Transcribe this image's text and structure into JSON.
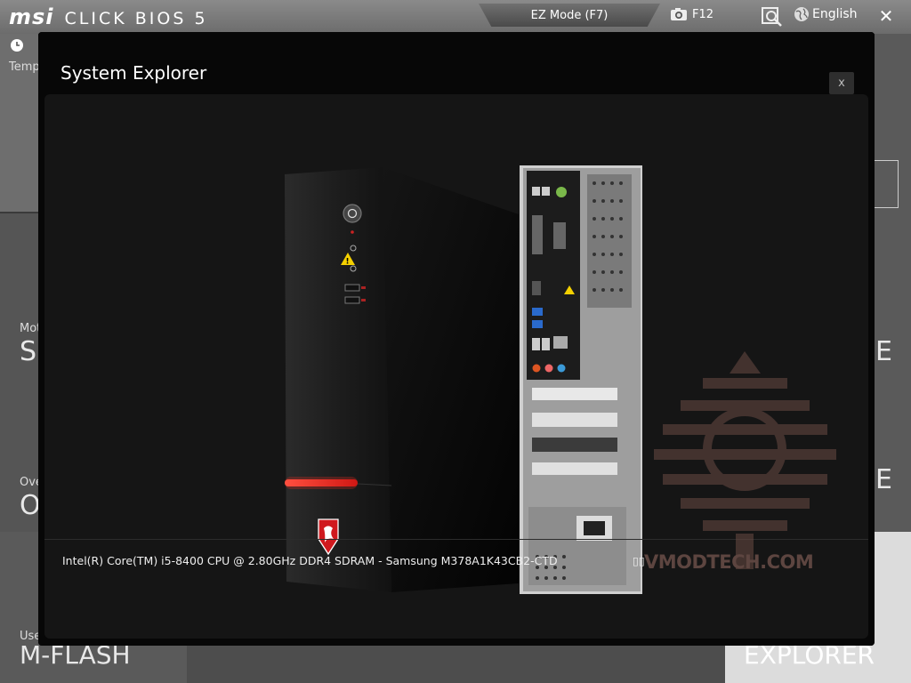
{
  "topbar": {
    "brand_logo": "msi",
    "brand_title": "CLICK BIOS 5",
    "mode_tab": "EZ Mode (F7)",
    "screenshot_key": "F12",
    "language": "English",
    "close_label": "✕"
  },
  "background": {
    "temp_label": "Temp",
    "tiles": [
      {
        "small": "Mot",
        "big": "SI"
      },
      {
        "small": "Ove",
        "big": "O"
      },
      {
        "small": "Use",
        "big": "M-FLASH"
      }
    ],
    "right_tiles": [
      {
        "big": "E"
      },
      {
        "big": "E"
      },
      {
        "big": "EXPLORER"
      }
    ]
  },
  "modal": {
    "title": "System Explorer",
    "close_label": "x",
    "info_line": "Intel(R) Core(TM) i5-8400 CPU @ 2.80GHz DDR4 SDRAM - Samsung M378A1K43CB2-CTD",
    "info_extra": "▯▯"
  },
  "watermark": {
    "text": "VMODTECH.COM"
  },
  "colors": {
    "accent_red": "#e8262a",
    "modal_bg": "#070707",
    "panel_bg": "#151515"
  }
}
